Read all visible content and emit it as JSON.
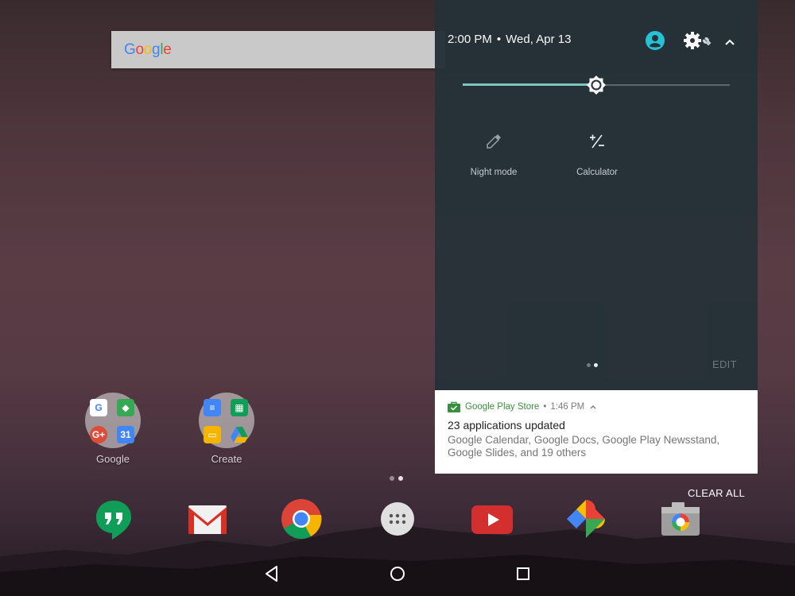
{
  "status": {
    "time": "2:00 PM",
    "separator": "•",
    "date": "Wed, Apr 13"
  },
  "search": {
    "logo_letters": [
      "G",
      "o",
      "o",
      "g",
      "l",
      "e"
    ],
    "logo_colors": [
      "#4285F4",
      "#EA4335",
      "#FBBC05",
      "#4285F4",
      "#34A853",
      "#EA4335"
    ]
  },
  "folders": [
    {
      "label": "Google"
    },
    {
      "label": "Create"
    }
  ],
  "quick_settings": {
    "brightness_level": 0.5,
    "tiles": [
      {
        "label": "Night mode",
        "icon": "eyedropper-icon"
      },
      {
        "label": "Calculator",
        "icon": "calculator-plus-minus-icon"
      }
    ],
    "page_count": 2,
    "active_page": 2,
    "edit_label": "EDIT"
  },
  "notification": {
    "app": "Google Play Store",
    "separator": "•",
    "time": "1:46 PM",
    "title": "23 applications updated",
    "body": "Google Calendar, Google Docs, Google Play Newsstand, Google Slides, and 19 others"
  },
  "clear_all_label": "CLEAR ALL",
  "colors": {
    "shade_bg": "#263238",
    "accent": "#80cbc4",
    "user_icon": "#26c6da",
    "play_green": "#3a8f3e"
  },
  "dock": [
    "hangouts-icon",
    "gmail-icon",
    "chrome-icon",
    "app-drawer-icon",
    "youtube-icon",
    "photos-icon",
    "camera-icon"
  ],
  "nav": [
    "back-icon",
    "home-icon",
    "recents-icon"
  ]
}
